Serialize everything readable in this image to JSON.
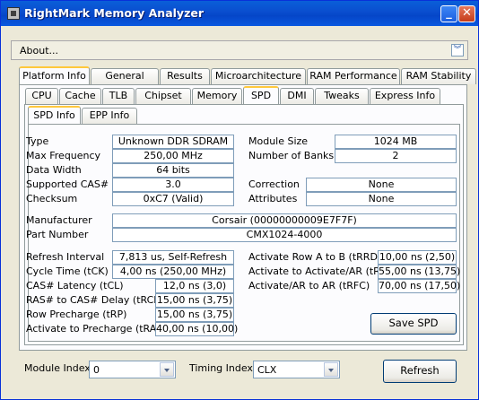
{
  "window": {
    "title": "RightMark Memory Analyzer",
    "minimize_label": "_",
    "close_label": "✕"
  },
  "about": {
    "label": "About...",
    "chevron_icon": "double-chevron-down-icon"
  },
  "tabs_main": [
    "Platform Info",
    "General",
    "Results",
    "Microarchitecture",
    "RAM Performance",
    "RAM Stability"
  ],
  "tabs_sub": [
    "CPU",
    "Cache",
    "TLB",
    "Chipset",
    "Memory",
    "SPD",
    "DMI",
    "Tweaks",
    "Express Info"
  ],
  "tabs_spd": [
    "SPD Info",
    "EPP Info"
  ],
  "spd": {
    "type": {
      "label": "Type",
      "value": "Unknown DDR SDRAM"
    },
    "max_frequency": {
      "label": "Max Frequency",
      "value": "250,00 MHz"
    },
    "data_width": {
      "label": "Data Width",
      "value": "64 bits"
    },
    "supported_cas": {
      "label": "Supported CAS#",
      "value": "3.0"
    },
    "checksum": {
      "label": "Checksum",
      "value": "0xC7 (Valid)"
    },
    "module_size": {
      "label": "Module Size",
      "value": "1024 MB"
    },
    "number_of_banks": {
      "label": "Number of Banks",
      "value": "2"
    },
    "correction": {
      "label": "Correction",
      "value": "None"
    },
    "attributes": {
      "label": "Attributes",
      "value": "None"
    },
    "manufacturer": {
      "label": "Manufacturer",
      "value": "Corsair (00000000009E7F7F)"
    },
    "part_number": {
      "label": "Part Number",
      "value": "CMX1024-4000"
    },
    "refresh_interval": {
      "label": "Refresh Interval",
      "value": "7,813 us, Self-Refresh"
    },
    "cycle_time": {
      "label": "Cycle Time (tCK)",
      "value": "4,00 ns (250,00 MHz)"
    },
    "cas_latency": {
      "label": "CAS# Latency (tCL)",
      "value": "12,0 ns (3,0)"
    },
    "ras_to_cas": {
      "label": "RAS# to CAS# Delay (tRCD)",
      "value": "15,00 ns (3,75)"
    },
    "row_precharge": {
      "label": "Row Precharge (tRP)",
      "value": "15,00 ns (3,75)"
    },
    "activate_to_precharge": {
      "label": "Activate to Precharge (tRAS)",
      "value": "40,00 ns (10,00)"
    },
    "trrd": {
      "label": "Activate Row A to B (tRRD)",
      "value": "10,00 ns (2,50)"
    },
    "trc": {
      "label": "Activate to Activate/AR (tRC)",
      "value": "55,00 ns (13,75)"
    },
    "trfc": {
      "label": "Activate/AR to AR (tRFC)",
      "value": "70,00 ns (17,50)"
    },
    "save_button": "Save SPD"
  },
  "bottom": {
    "module_index_label": "Module Index",
    "module_index_value": "0",
    "timing_index_label": "Timing Index",
    "timing_index_value": "CLX",
    "refresh_button": "Refresh"
  }
}
